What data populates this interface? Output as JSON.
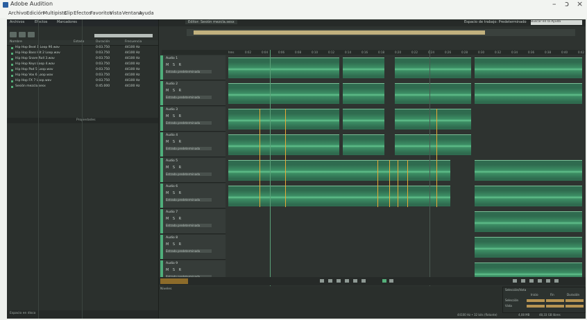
{
  "window": {
    "title": "Adobe Audition",
    "min": "–",
    "max": "ↄ",
    "close": "×"
  },
  "menus": [
    "Archivo",
    "Edición",
    "Multipista",
    "Clip",
    "Efectos",
    "Favoritos",
    "Vista",
    "Ventana",
    "Ayuda"
  ],
  "left_panel": {
    "tabs": [
      "Archivos",
      "Efectos",
      "Marcadores"
    ],
    "columns": [
      "Nombre",
      "Estado",
      "Duración",
      "Frecuencia"
    ],
    "files": [
      {
        "name": "Hip Hop Beat 1 Loop 90.wav",
        "dur": "0:03.750",
        "rate": "44100 Hz"
      },
      {
        "name": "Hip Hop Bass Hit 2 Loop.wav",
        "dur": "0:03.750",
        "rate": "44100 Hz"
      },
      {
        "name": "Hip Hop Snare Roll 3.wav",
        "dur": "0:03.750",
        "rate": "44100 Hz"
      },
      {
        "name": "Hip Hop Keys Loop 4.wav",
        "dur": "0:03.750",
        "rate": "44100 Hz"
      },
      {
        "name": "Hip Hop Pad 5 Loop.wav",
        "dur": "0:03.750",
        "rate": "44100 Hz"
      },
      {
        "name": "Hip Hop Vox 6 Loop.wav",
        "dur": "0:03.750",
        "rate": "44100 Hz"
      },
      {
        "name": "Hip Hop FX 7 Loop.wav",
        "dur": "0:03.750",
        "rate": "44100 Hz"
      },
      {
        "name": "Sesión mezcla.sesx",
        "dur": "0:45.000",
        "rate": "44100 Hz"
      }
    ],
    "sub_label": "Propiedades",
    "footer": "Espacio en disco"
  },
  "editor": {
    "tab": "Editor: Sesión mezcla.sesx",
    "workspace": "Espacio de trabajo: Predeterminado",
    "search": "Buscar en la Ayuda",
    "ruler": [
      "hms",
      "0:02",
      "0:04",
      "0:06",
      "0:08",
      "0:10",
      "0:12",
      "0:14",
      "0:16",
      "0:18",
      "0:20",
      "0:22",
      "0:24",
      "0:26",
      "0:28",
      "0:30",
      "0:32",
      "0:34",
      "0:36",
      "0:38",
      "0:40",
      "0:42"
    ],
    "tracks": [
      "Audio 1",
      "Audio 2",
      "Audio 3",
      "Audio 4",
      "Audio 5",
      "Audio 6",
      "Audio 7",
      "Audio 8",
      "Audio 9"
    ],
    "track_controls": "M S R",
    "track_input": "Entrada predeterminada",
    "mixer_label": "Niveles",
    "selection": {
      "title": "Selección/Vista",
      "inicio": "Inicio",
      "fin": "Fin",
      "duracion": "Duración",
      "sel": "Selección",
      "vista": "Vista"
    },
    "status": [
      "44100 Hz • 32 bits (flotante)",
      "4,08 MB",
      "48,33 GB libres"
    ]
  }
}
